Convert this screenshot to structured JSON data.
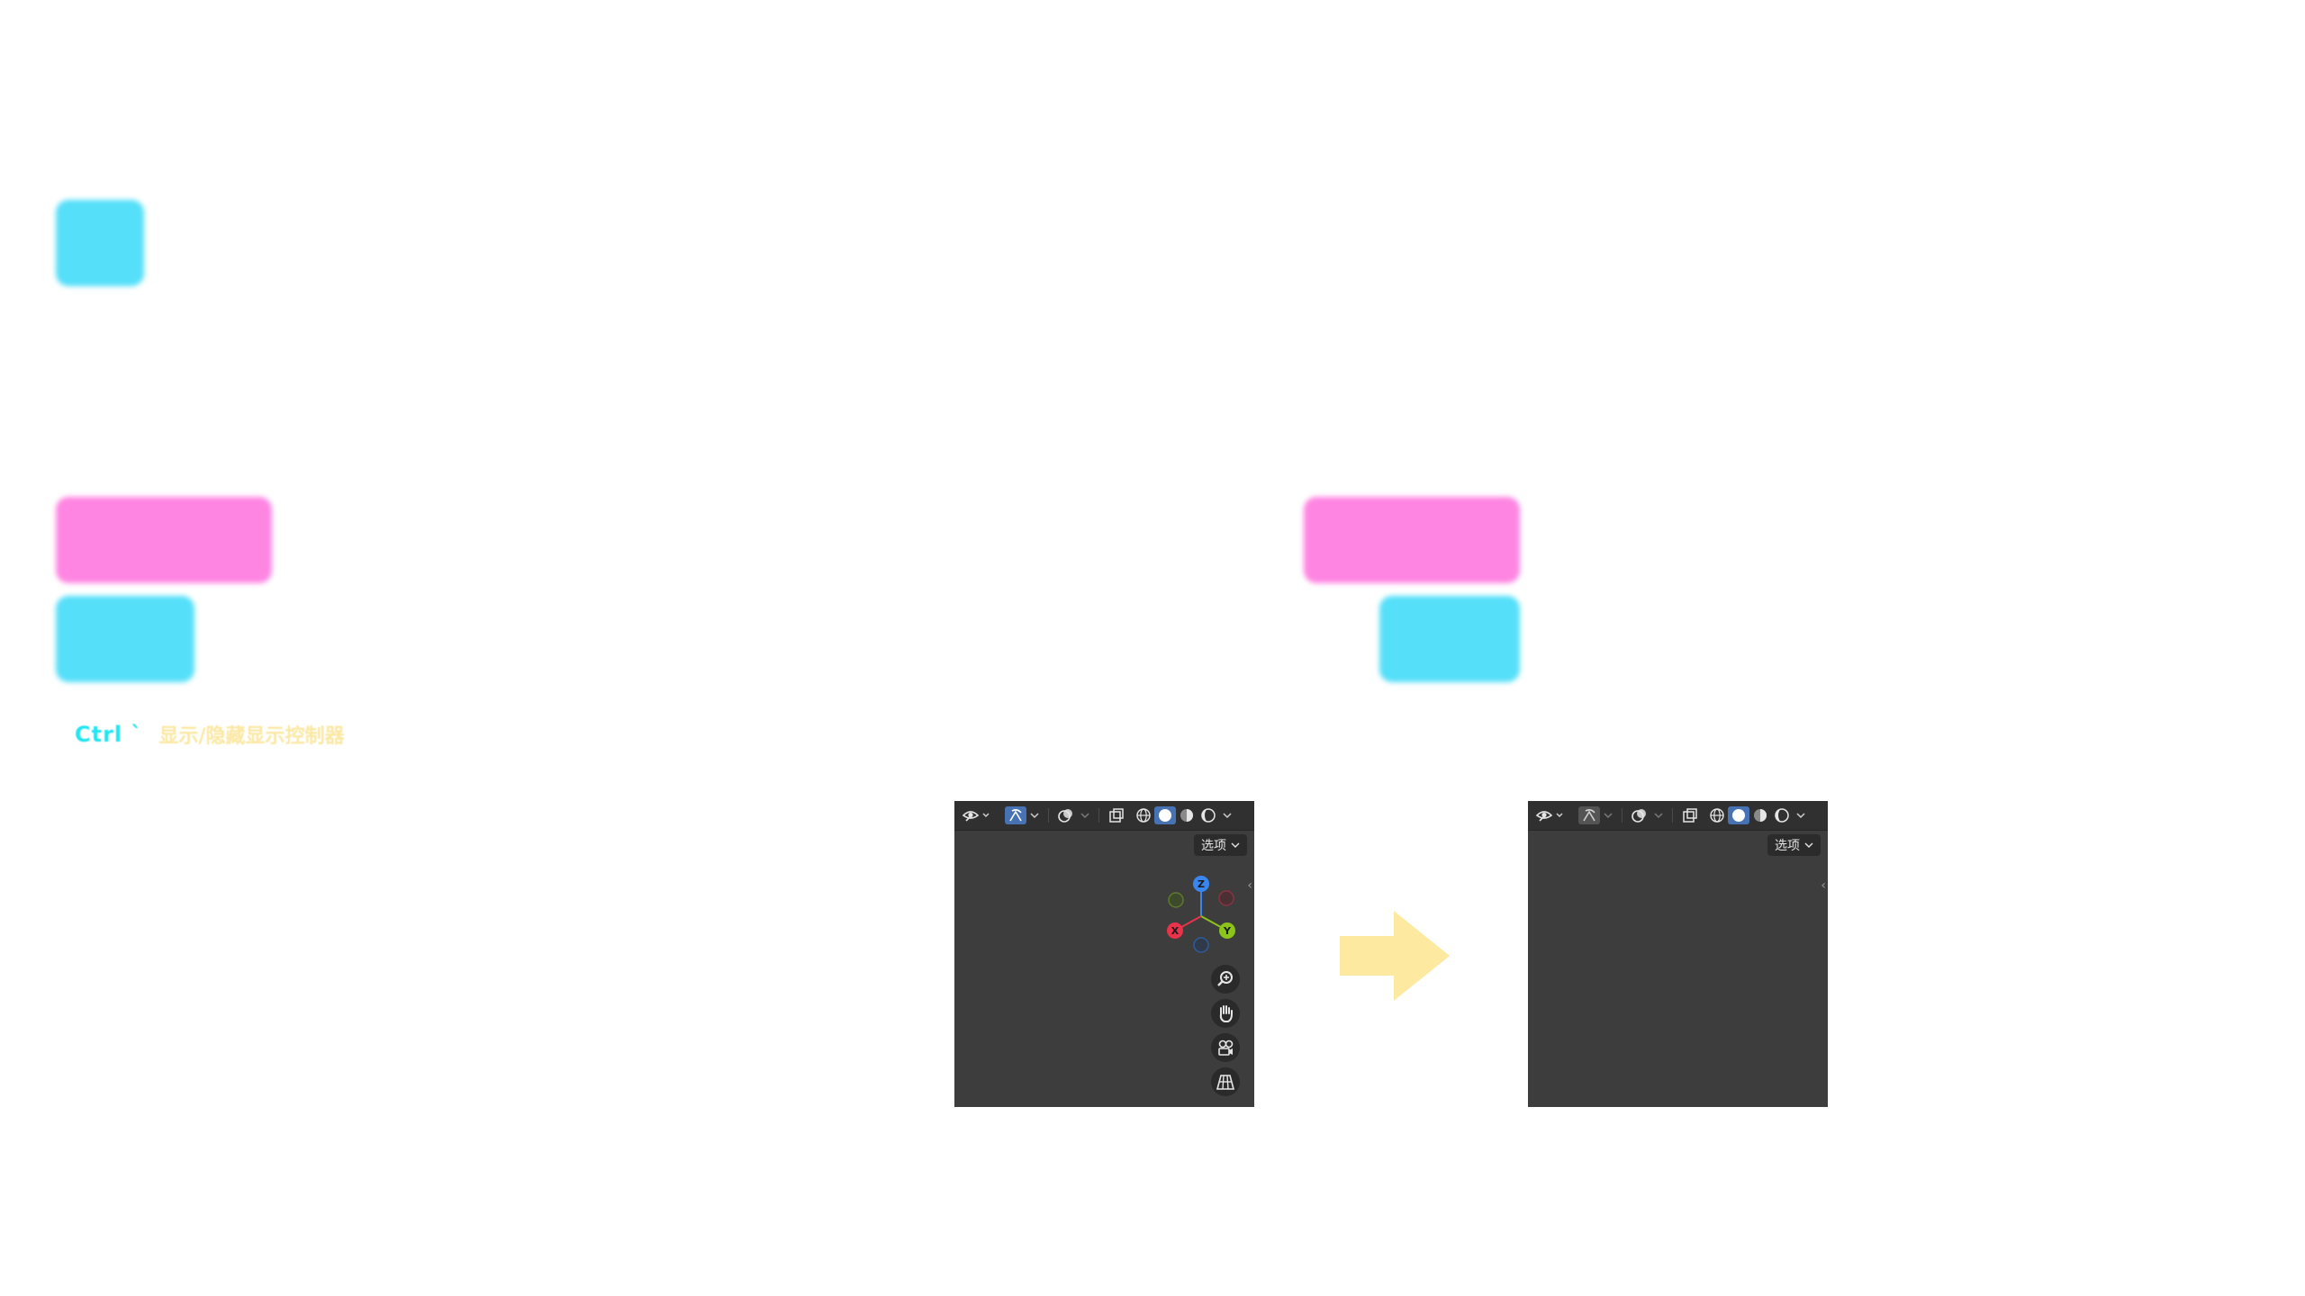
{
  "shortcut": {
    "key": "Ctrl `",
    "description": "显示/隐藏显示控制器"
  },
  "viewport_before": {
    "options_label": "选项",
    "gizmo_labels": {
      "z": "Z",
      "y": "Y",
      "x": "X"
    },
    "nav_buttons": [
      "zoom-icon",
      "hand-pan-icon",
      "camera-icon",
      "grid-ortho-icon"
    ]
  },
  "viewport_after": {
    "options_label": "选项"
  },
  "colors": {
    "cyan": "#55dff9",
    "pink": "#ff85e2",
    "arrow": "#fde9a0",
    "viewport_bg": "#3d3d3d",
    "axis_x": "#e8334a",
    "axis_y": "#8bc51a",
    "axis_z": "#3a86f0"
  }
}
